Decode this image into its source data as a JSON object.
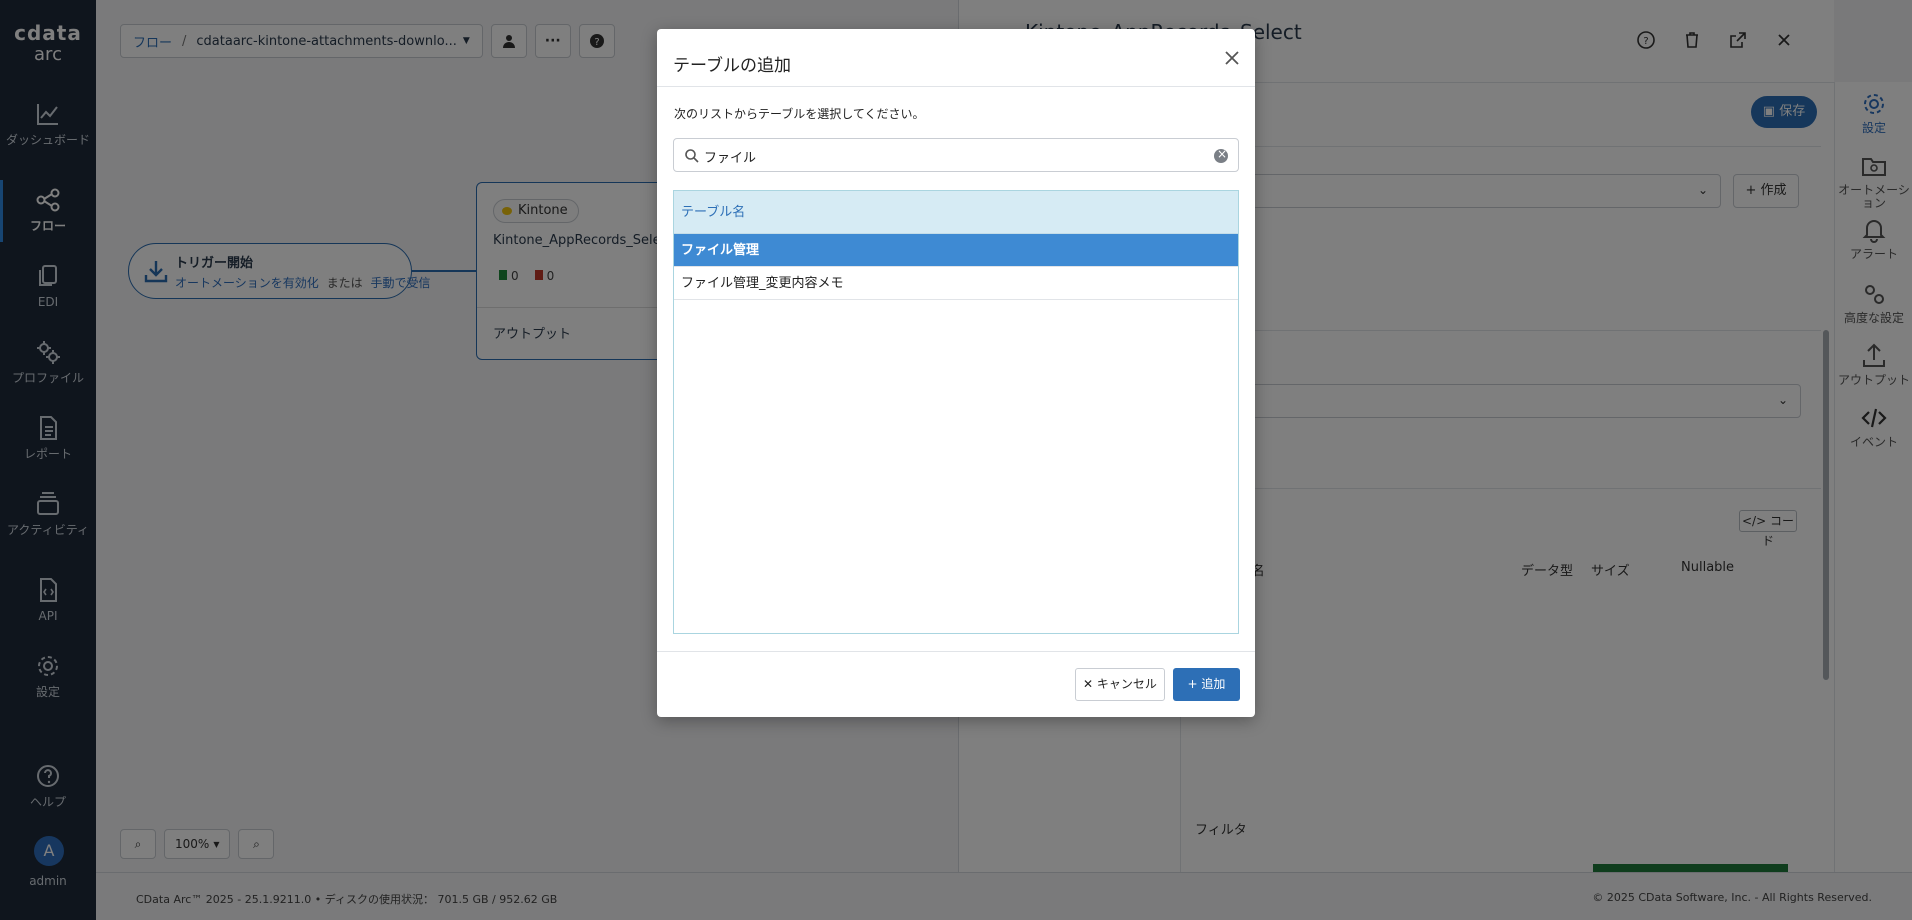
{
  "brand": {
    "logo_top": "cdata",
    "logo_bottom": "arc"
  },
  "sidebar": {
    "items": [
      {
        "label": "ダッシュボード",
        "icon": "chart-line-icon"
      },
      {
        "label": "フロー",
        "icon": "flow-icon",
        "active": true
      },
      {
        "label": "EDI",
        "icon": "copy-documents-icon"
      },
      {
        "label": "プロファイル",
        "icon": "gears-icon"
      },
      {
        "label": "レポート",
        "icon": "report-document-icon"
      },
      {
        "label": "アクティビティ",
        "icon": "layers-icon"
      },
      {
        "label": "API",
        "icon": "api-code-icon"
      },
      {
        "label": "設定",
        "icon": "gear-icon"
      },
      {
        "label": "ヘルプ",
        "icon": "help-icon"
      }
    ],
    "user": {
      "initial": "A",
      "name": "admin"
    }
  },
  "canvas": {
    "breadcrumb_root": "フロー",
    "breadcrumb_sep": "/",
    "breadcrumb_current": "cdataarc-kintone-attachments-downlo...",
    "trigger": {
      "title": "トリガー開始",
      "line_a": "オートメーションを有効化",
      "or": "または",
      "line_b": "手動で受信"
    },
    "node": {
      "connector": "Kintone",
      "name": "Kintone_AppRecords_Select",
      "success_count": "0",
      "error_count": "0",
      "output_label": "アウトプット"
    },
    "zoom_level": "100%"
  },
  "panel": {
    "title": "Kintone_AppRecords_Select",
    "save_label": "保存",
    "create_label": "作成",
    "code_label": "コード",
    "columns": {
      "name": "カラム名",
      "type": "データ型",
      "size": "サイズ",
      "nullable": "Nullable"
    },
    "filter_label": "フィルタ"
  },
  "right_nav": [
    {
      "label": "設定",
      "icon": "gear-icon",
      "active": true
    },
    {
      "label": "オートメーション",
      "icon": "folder-gear-icon"
    },
    {
      "label": "アラート",
      "icon": "bell-icon"
    },
    {
      "label": "高度な設定",
      "icon": "gears-icon"
    },
    {
      "label": "アウトプット",
      "icon": "upload-icon"
    },
    {
      "label": "イベント",
      "icon": "code-icon"
    }
  ],
  "footer": {
    "version": "CData Arc™ 2025 - 25.1.9211.0",
    "disk": "ディスクの使用状況： 701.5 GB / 952.62 GB",
    "copyright": "© 2025 CData Software, Inc. - All Rights Reserved."
  },
  "modal": {
    "title": "テーブルの追加",
    "instruction": "次のリストからテーブルを選択してください。",
    "search_value": "ファイル",
    "table_header": "テーブル名",
    "rows": [
      "ファイル管理",
      "ファイル管理_変更内容メモ"
    ],
    "selected_index": 0,
    "cancel_label": "キャンセル",
    "add_label": "追加"
  },
  "colors": {
    "sidebar_bg": "#1e2a3a",
    "accent": "#2d6fb6",
    "selected_row": "#3e8ad3",
    "table_header_bg": "#d6ebf4"
  }
}
